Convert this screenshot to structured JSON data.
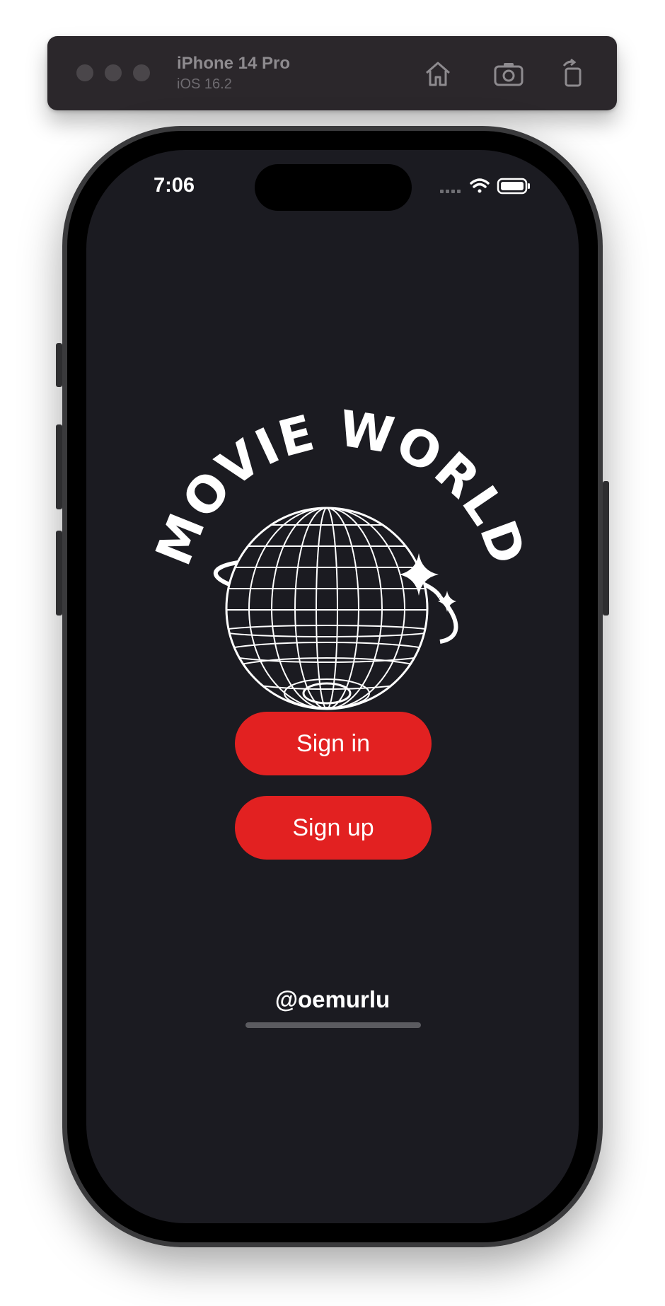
{
  "simulator": {
    "device_name": "iPhone 14 Pro",
    "os_version": "iOS 16.2",
    "icons": [
      "home-icon",
      "screenshot-icon",
      "rotate-icon"
    ]
  },
  "status_bar": {
    "time": "7:06",
    "icons": [
      "signal-icon",
      "wifi-icon",
      "battery-icon"
    ]
  },
  "logo": {
    "text": "MOVIE WORLD"
  },
  "actions": {
    "sign_in_label": "Sign in",
    "sign_up_label": "Sign up"
  },
  "footer": {
    "handle": "@oemurlu"
  },
  "colors": {
    "background": "#1b1b21",
    "accent": "#e22121",
    "text": "#ffffff"
  }
}
